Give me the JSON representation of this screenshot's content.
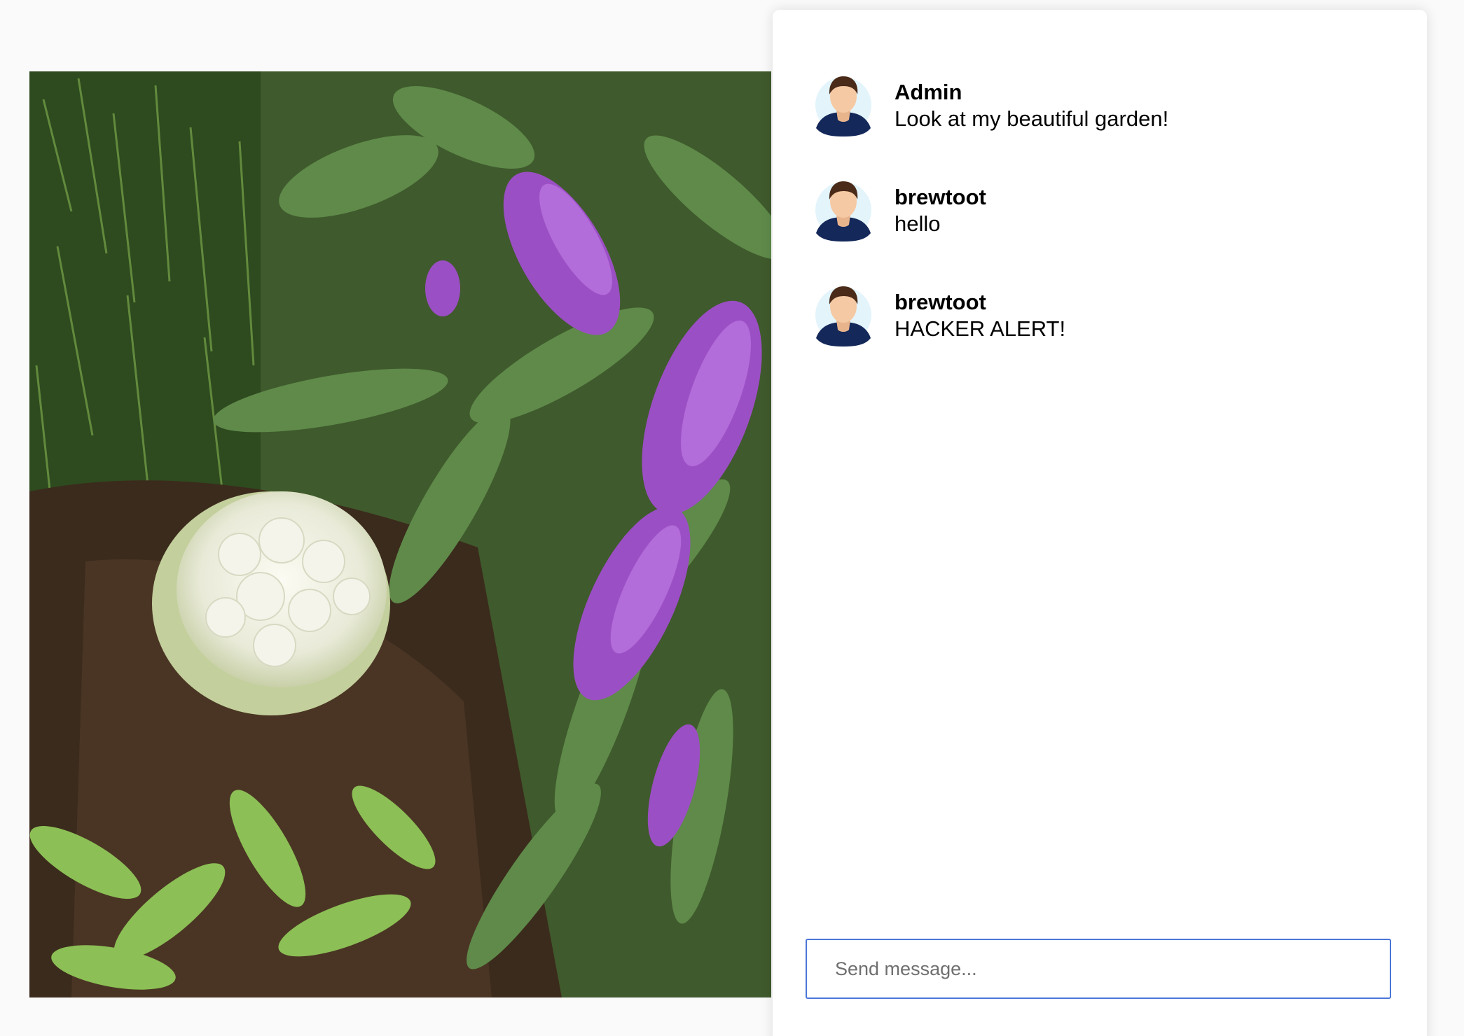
{
  "photo": {
    "description_icon": "garden-photo"
  },
  "chat": {
    "messages": [
      {
        "author": "Admin",
        "text": "Look at my beautiful garden!",
        "avatar": "user-avatar-icon"
      },
      {
        "author": "brewtoot",
        "text": "hello",
        "avatar": "user-avatar-icon"
      },
      {
        "author": "brewtoot",
        "text": "HACKER ALERT!",
        "avatar": "user-avatar-icon"
      }
    ],
    "composer": {
      "placeholder": "Send message...",
      "value": ""
    }
  },
  "colors": {
    "page_background": "#fafafa",
    "panel_background": "#ffffff",
    "input_border": "#4a76d6",
    "avatar_shirt": "#14285a",
    "avatar_hair": "#4a2a18",
    "avatar_skin": "#f5c9a3",
    "avatar_bg": "#e3f4fb"
  }
}
